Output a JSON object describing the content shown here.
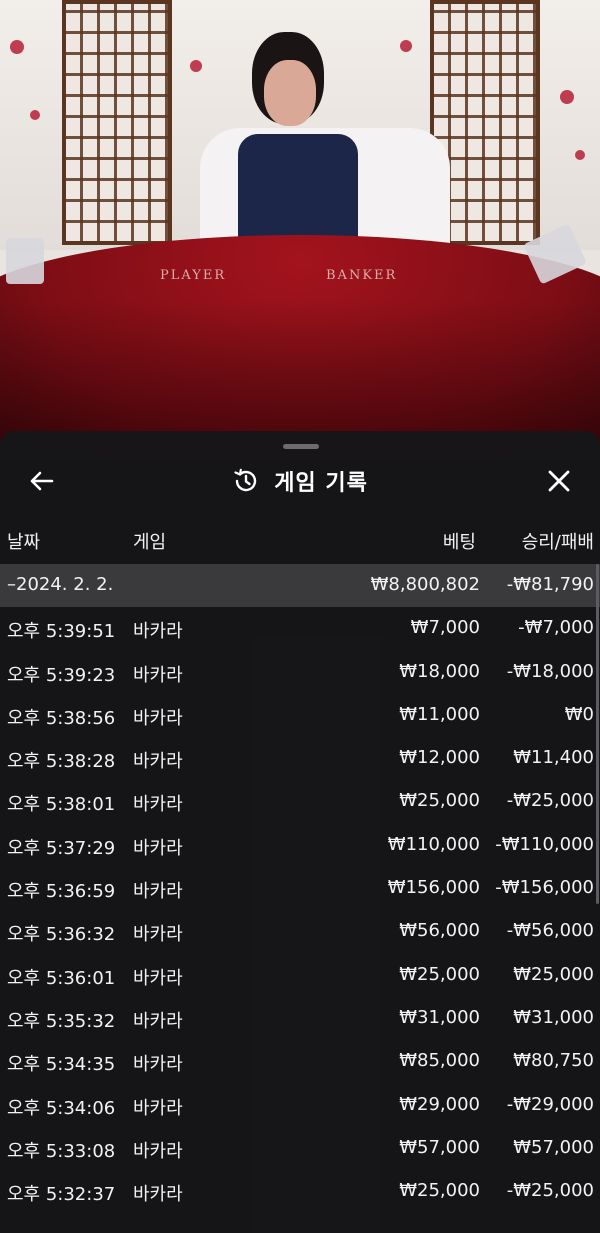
{
  "header": {
    "title": "게임 기록"
  },
  "video": {
    "player_label": "PLAYER",
    "banker_label": "BANKER"
  },
  "columns": {
    "date": "날짜",
    "game": "게임",
    "bet": "베팅",
    "win_loss": "승리/패배"
  },
  "summary": {
    "date": "–2024. 2. 2.",
    "game": "",
    "bet": "₩8,800,802",
    "win_loss": "-₩81,790"
  },
  "rows": [
    {
      "date": "오후 5:39:51",
      "game": "바카라",
      "bet": "₩7,000",
      "win_loss": "-₩7,000"
    },
    {
      "date": "오후 5:39:23",
      "game": "바카라",
      "bet": "₩18,000",
      "win_loss": "-₩18,000"
    },
    {
      "date": "오후 5:38:56",
      "game": "바카라",
      "bet": "₩11,000",
      "win_loss": "₩0"
    },
    {
      "date": "오후 5:38:28",
      "game": "바카라",
      "bet": "₩12,000",
      "win_loss": "₩11,400"
    },
    {
      "date": "오후 5:38:01",
      "game": "바카라",
      "bet": "₩25,000",
      "win_loss": "-₩25,000"
    },
    {
      "date": "오후 5:37:29",
      "game": "바카라",
      "bet": "₩110,000",
      "win_loss": "-₩110,000"
    },
    {
      "date": "오후 5:36:59",
      "game": "바카라",
      "bet": "₩156,000",
      "win_loss": "-₩156,000"
    },
    {
      "date": "오후 5:36:32",
      "game": "바카라",
      "bet": "₩56,000",
      "win_loss": "-₩56,000"
    },
    {
      "date": "오후 5:36:01",
      "game": "바카라",
      "bet": "₩25,000",
      "win_loss": "₩25,000"
    },
    {
      "date": "오후 5:35:32",
      "game": "바카라",
      "bet": "₩31,000",
      "win_loss": "₩31,000"
    },
    {
      "date": "오후 5:34:35",
      "game": "바카라",
      "bet": "₩85,000",
      "win_loss": "₩80,750"
    },
    {
      "date": "오후 5:34:06",
      "game": "바카라",
      "bet": "₩29,000",
      "win_loss": "-₩29,000"
    },
    {
      "date": "오후 5:33:08",
      "game": "바카라",
      "bet": "₩57,000",
      "win_loss": "₩57,000"
    },
    {
      "date": "오후 5:32:37",
      "game": "바카라",
      "bet": "₩25,000",
      "win_loss": "-₩25,000"
    }
  ],
  "icons": {
    "back": "arrow-left-icon",
    "history": "history-clock-icon",
    "close": "close-icon"
  },
  "colors": {
    "sheet_bg": "#161618",
    "summary_row_bg": "#3a3a3d",
    "table_felt": "#8e0f18"
  }
}
